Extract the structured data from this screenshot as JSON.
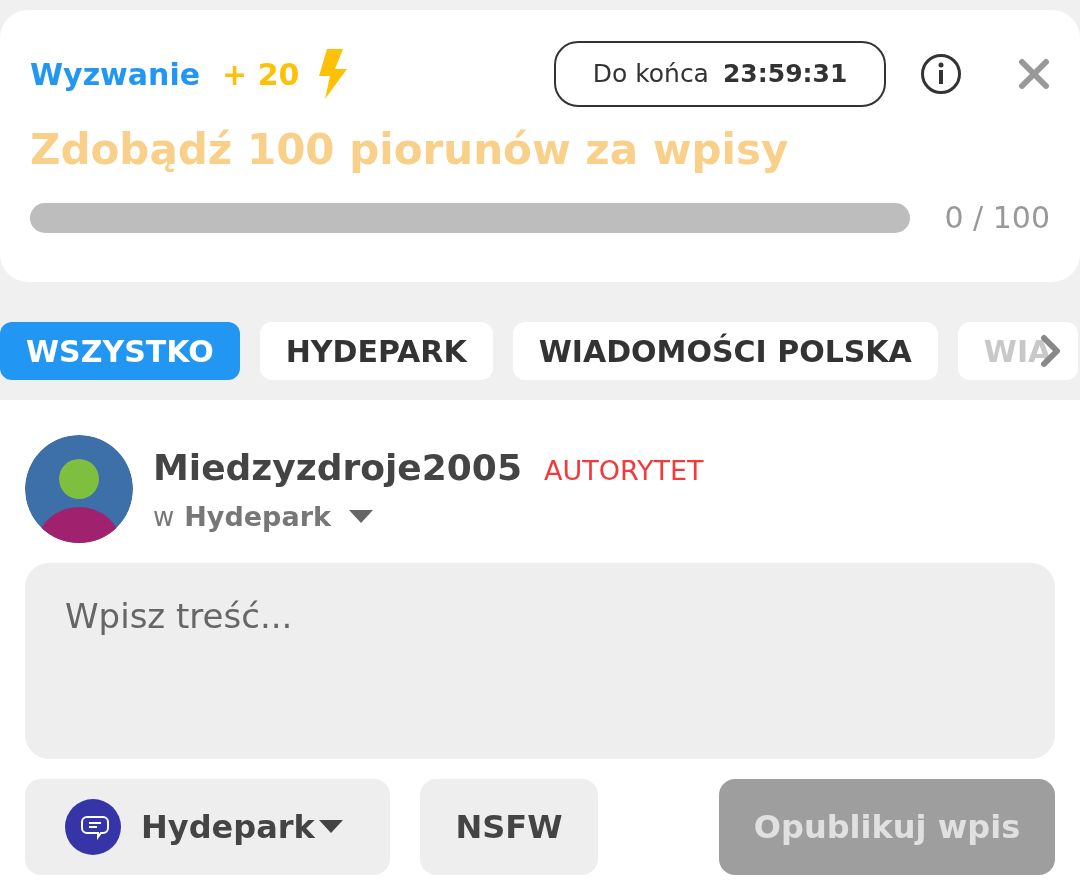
{
  "challenge": {
    "label": "Wyzwanie",
    "reward": "+ 20",
    "timer_label": "Do końca",
    "timer_value": "23:59:31",
    "title": "Zdobądź 100 piorunów za wpisy",
    "level": 0,
    "progress": "0 / 100"
  },
  "tabs": [
    {
      "label": "WSZYSTKO",
      "selected": true
    },
    {
      "label": "HYDEPARK",
      "selected": false
    },
    {
      "label": "WIADOMOŚCI POLSKA",
      "selected": false
    },
    {
      "label": "WIA",
      "selected": false
    }
  ],
  "post": {
    "username": "Miedzyzdroje2005",
    "rank": "AUTORYTET",
    "in_prefix": "w",
    "community": "Hydepark",
    "placeholder": "Wpisz treść...",
    "community_button": "Hydepark",
    "nsfw_button": "NSFW",
    "publish_button": "Opublikuj wpis",
    "publish_disabled": true
  }
}
